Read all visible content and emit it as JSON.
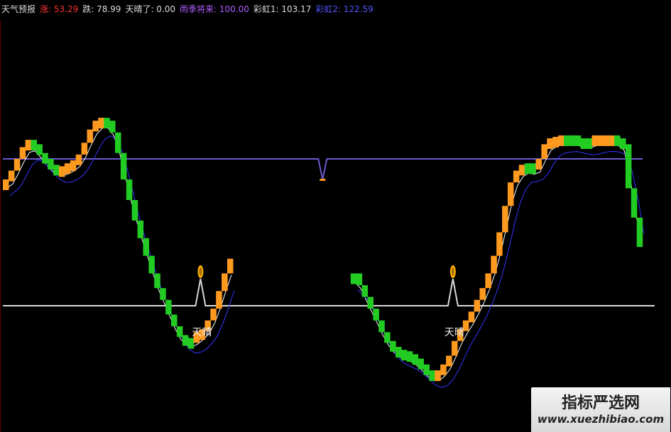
{
  "header": {
    "title": "天气预报",
    "items": [
      {
        "label": "涨: 53.29",
        "color": "#ff3333"
      },
      {
        "label": "跌: 78.99",
        "color": "#dddddd"
      },
      {
        "label": "天晴了: 0.00",
        "color": "#dddddd"
      },
      {
        "label": "雨季将来: 100.00",
        "color": "#b060ff"
      },
      {
        "label": "彩虹1: 103.17",
        "color": "#dddddd"
      },
      {
        "label": "彩虹2: 122.59",
        "color": "#5555ff"
      }
    ]
  },
  "annotations": [
    {
      "text": "天晴",
      "x": 92,
      "y": -2
    },
    {
      "text": "天晴",
      "x": 230,
      "y": -8
    }
  ],
  "watermark": {
    "title": "指标严选网",
    "url": "www.xuezhibiao.com"
  },
  "colors": {
    "up": "#ff9a1f",
    "down": "#22cc22",
    "line1": "#ffffff",
    "line2": "#3333ff",
    "purple": "#6a5acd",
    "white_line": "#d8d8d8",
    "marker": "#ffb000"
  },
  "chart_data": {
    "type": "line",
    "y_axis": {
      "ylim": [
        -10,
        140
      ]
    },
    "reference_lines": [
      {
        "name": "雨季将来",
        "value": 100
      },
      {
        "name": "天晴了",
        "value": 0
      }
    ],
    "segments": [
      {
        "x_start": 0,
        "values": [
          86,
          92,
          100,
          108,
          113,
          110,
          104,
          100,
          96,
          94,
          95,
          97,
          99,
          103,
          111,
          120,
          126,
          128,
          126,
          118,
          104,
          86,
          72,
          58,
          46,
          34,
          22,
          12,
          4,
          -6,
          -14,
          -20,
          -22,
          -22,
          -18,
          -16,
          -10,
          -2,
          10,
          22,
          32
        ],
        "colors": [
          "u",
          "u",
          "u",
          "u",
          "u",
          "d",
          "d",
          "d",
          "d",
          "d",
          "u",
          "u",
          "u",
          "u",
          "u",
          "u",
          "u",
          "u",
          "d",
          "d",
          "d",
          "d",
          "d",
          "d",
          "d",
          "d",
          "d",
          "d",
          "d",
          "d",
          "d",
          "d",
          "d",
          "d",
          "u",
          "u",
          "u",
          "u",
          "u",
          "u",
          "u"
        ],
        "signals": [
          {
            "index": 36,
            "label": "天晴"
          }
        ]
      },
      {
        "x_start": 62,
        "values": [
          22,
          14,
          6,
          -2,
          -10,
          -18,
          -24,
          -28,
          -30,
          -31,
          -33,
          -36,
          -40,
          -44,
          -46,
          -44,
          -40,
          -34,
          -24,
          -16,
          -10,
          -4,
          4,
          12,
          22,
          34,
          50,
          68,
          84,
          92,
          96,
          97,
          94,
          100,
          110,
          114,
          115,
          116,
          116,
          116,
          114,
          113,
          114,
          116,
          116,
          116,
          116,
          114,
          110,
          80,
          60,
          40
        ],
        "colors": [
          "d",
          "d",
          "d",
          "d",
          "d",
          "d",
          "d",
          "d",
          "d",
          "d",
          "d",
          "d",
          "d",
          "d",
          "d",
          "u",
          "u",
          "u",
          "u",
          "u",
          "u",
          "u",
          "u",
          "u",
          "u",
          "u",
          "u",
          "u",
          "u",
          "u",
          "u",
          "d",
          "d",
          "u",
          "u",
          "u",
          "u",
          "u",
          "d",
          "d",
          "d",
          "d",
          "d",
          "u",
          "u",
          "u",
          "u",
          "d",
          "d",
          "d",
          "d",
          "d"
        ],
        "signals": [
          {
            "index": 19,
            "label": "天晴"
          }
        ]
      }
    ],
    "dip_marker": {
      "x": 57,
      "value": 86
    },
    "series": [
      {
        "name": "彩虹1",
        "color": "#ffffff"
      },
      {
        "name": "彩虹2",
        "color": "#3333ff"
      }
    ]
  }
}
